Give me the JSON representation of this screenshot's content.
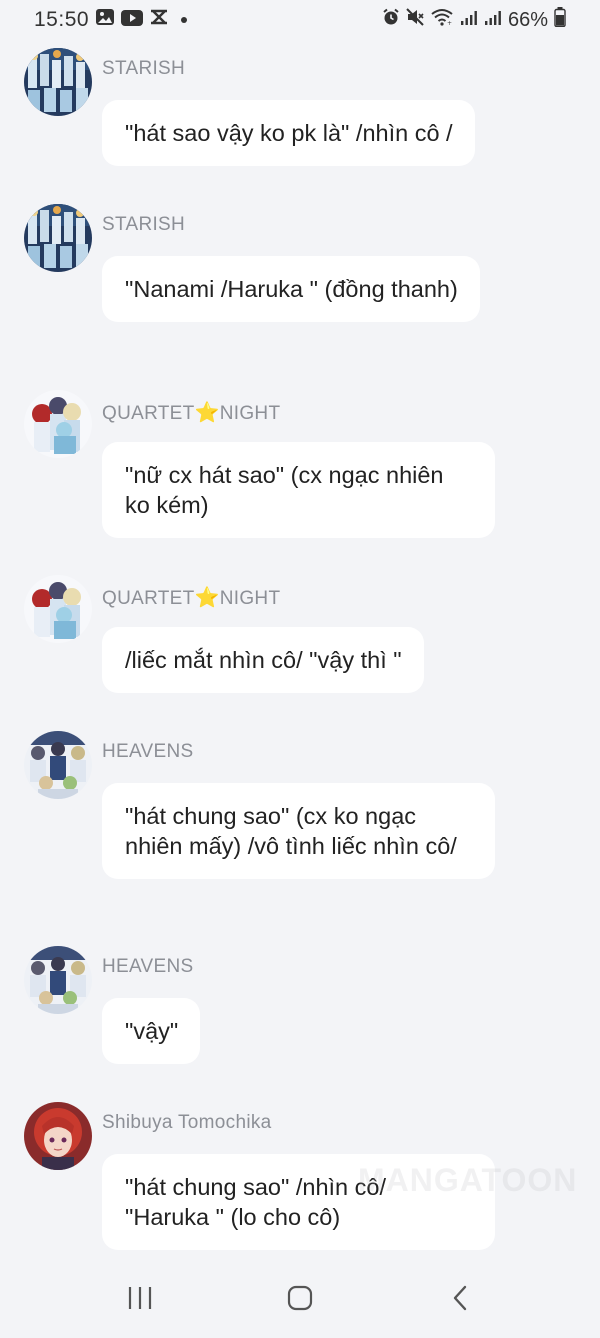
{
  "status_bar": {
    "time": "15:50",
    "battery": "66%",
    "left_icons": [
      "gallery-icon",
      "youtube-icon",
      "capcut-icon",
      "notification-dot"
    ],
    "right_icons": [
      "alarm-icon",
      "mute-icon",
      "wifi-icon",
      "signal-icon",
      "signal-icon",
      "battery-icon"
    ]
  },
  "messages": [
    {
      "sender": "STARISH",
      "text": "\"hát sao vậy ko pk là\" /nhìn cô /",
      "avatar": "starish-avatar"
    },
    {
      "sender": "STARISH",
      "text": "\"Nanami /Haruka \" (đồng thanh)",
      "avatar": "starish-avatar"
    },
    {
      "sender_parts": [
        "QUARTET",
        "⭐",
        "NIGHT"
      ],
      "text": "\"nữ cx hát sao\" (cx ngạc nhiên ko kém)",
      "avatar": "quartet-night-avatar"
    },
    {
      "sender_parts": [
        "QUARTET",
        "⭐",
        "NIGHT"
      ],
      "text": "/liếc mắt nhìn cô/ \"vậy thì \"",
      "avatar": "quartet-night-avatar"
    },
    {
      "sender": "HEAVENS",
      "text": "\"hát chung sao\" (cx ko ngạc nhiên mấy) /vô tình liếc nhìn cô/",
      "avatar": "heavens-avatar"
    },
    {
      "sender": "HEAVENS",
      "text": "\"vậy\"",
      "avatar": "heavens-avatar"
    },
    {
      "sender": "Shibuya Tomochika",
      "text": "\"hát chung sao\" /nhìn cô/ \"Haruka \" (lo cho cô)",
      "avatar": "shibuya-avatar"
    }
  ],
  "watermark": "MANGATOON",
  "nav": {
    "recents": "recents-icon",
    "home": "home-icon",
    "back": "back-icon"
  },
  "colors": {
    "background": "#f3f4f7",
    "bubble": "#ffffff",
    "sender": "#8c8f96",
    "star": "#f2b600"
  }
}
